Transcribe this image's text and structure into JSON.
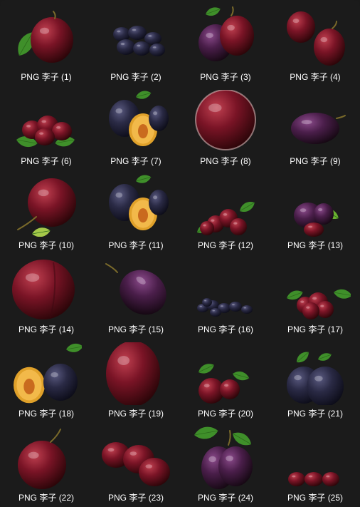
{
  "grid": {
    "items": [
      {
        "prefix": "PNG",
        "name": "李子",
        "index": "(1)",
        "thumb": "plum-with-leaf-icon"
      },
      {
        "prefix": "PNG",
        "name": "李子",
        "index": "(2)",
        "thumb": "dark-plums-cluster-icon"
      },
      {
        "prefix": "PNG",
        "name": "李子",
        "index": "(3)",
        "thumb": "plums-with-water-drops-icon"
      },
      {
        "prefix": "PNG",
        "name": "李子",
        "index": "(4)",
        "thumb": "two-plums-icon"
      },
      {
        "prefix": "PNG",
        "name": "李子",
        "index": "(6)",
        "thumb": "plums-on-leaves-icon"
      },
      {
        "prefix": "PNG",
        "name": "李子",
        "index": "(7)",
        "thumb": "halved-plum-icon"
      },
      {
        "prefix": "PNG",
        "name": "李子",
        "index": "(8)",
        "thumb": "red-plum-closeup-icon"
      },
      {
        "prefix": "PNG",
        "name": "李子",
        "index": "(9)",
        "thumb": "purple-plum-icon"
      },
      {
        "prefix": "PNG",
        "name": "李子",
        "index": "(10)",
        "thumb": "red-plum-with-leaf-icon"
      },
      {
        "prefix": "PNG",
        "name": "李子",
        "index": "(11)",
        "thumb": "halved-plum-icon"
      },
      {
        "prefix": "PNG",
        "name": "李子",
        "index": "(12)",
        "thumb": "plum-cluster-with-leaves-icon"
      },
      {
        "prefix": "PNG",
        "name": "李子",
        "index": "(13)",
        "thumb": "plums-with-leaf-icon"
      },
      {
        "prefix": "PNG",
        "name": "李子",
        "index": "(14)",
        "thumb": "large-red-plum-icon"
      },
      {
        "prefix": "PNG",
        "name": "李子",
        "index": "(15)",
        "thumb": "oval-purple-plum-icon"
      },
      {
        "prefix": "PNG",
        "name": "李子",
        "index": "(16)",
        "thumb": "small-blue-plums-icon"
      },
      {
        "prefix": "PNG",
        "name": "李子",
        "index": "(17)",
        "thumb": "red-cherry-plums-icon"
      },
      {
        "prefix": "PNG",
        "name": "李子",
        "index": "(18)",
        "thumb": "plum-and-half-icon"
      },
      {
        "prefix": "PNG",
        "name": "李子",
        "index": "(19)",
        "thumb": "dark-plum-oval-icon"
      },
      {
        "prefix": "PNG",
        "name": "李子",
        "index": "(20)",
        "thumb": "plum-branch-icon"
      },
      {
        "prefix": "PNG",
        "name": "李子",
        "index": "(21)",
        "thumb": "dark-plum-group-icon"
      },
      {
        "prefix": "PNG",
        "name": "李子",
        "index": "(22)",
        "thumb": "red-plum-stem-icon"
      },
      {
        "prefix": "PNG",
        "name": "李子",
        "index": "(23)",
        "thumb": "three-red-plums-icon"
      },
      {
        "prefix": "PNG",
        "name": "李子",
        "index": "(24)",
        "thumb": "two-purple-plums-icon"
      },
      {
        "prefix": "PNG",
        "name": "李子",
        "index": "(25)",
        "thumb": "three-small-plums-icon"
      }
    ]
  },
  "colors": {
    "background": "#1b1b1b",
    "label_text": "#ffffff"
  }
}
